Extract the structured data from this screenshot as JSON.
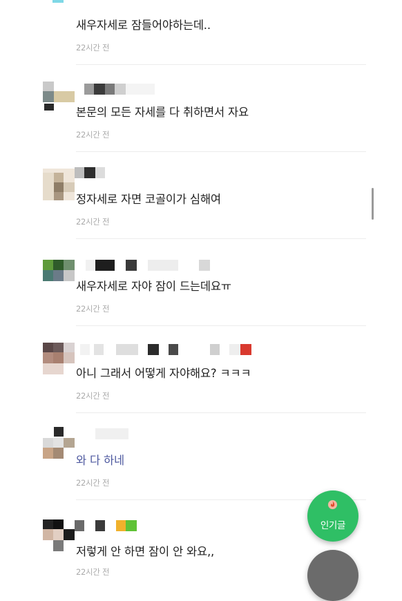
{
  "comments": [
    {
      "text": "새우자세로 잠들어야하는데..",
      "time": "22시간 전"
    },
    {
      "text": "본문의 모든 자세를 다 취하면서 자요",
      "time": "22시간 전"
    },
    {
      "text": "정자세로 자면 코골이가 심해여",
      "time": "22시간 전"
    },
    {
      "text": "새우자세로 자야 잠이 드는데요ㅠ",
      "time": "22시간 전"
    },
    {
      "text": "아니 그래서 어떻게 자야해요? ㅋㅋㅋ",
      "time": "22시간 전"
    },
    {
      "text": "와 다 하네",
      "time": "22시간 전"
    },
    {
      "text": "저렇게 안 하면 잠이 안 와요,,",
      "time": "22시간 전"
    }
  ],
  "fab": {
    "popular_label": "인기글"
  },
  "icons": {
    "popular": "flame-icon"
  },
  "colors": {
    "fab_green": "#2fbf65",
    "link_text": "#4f5aa0",
    "time_text": "#aaaaaa"
  }
}
